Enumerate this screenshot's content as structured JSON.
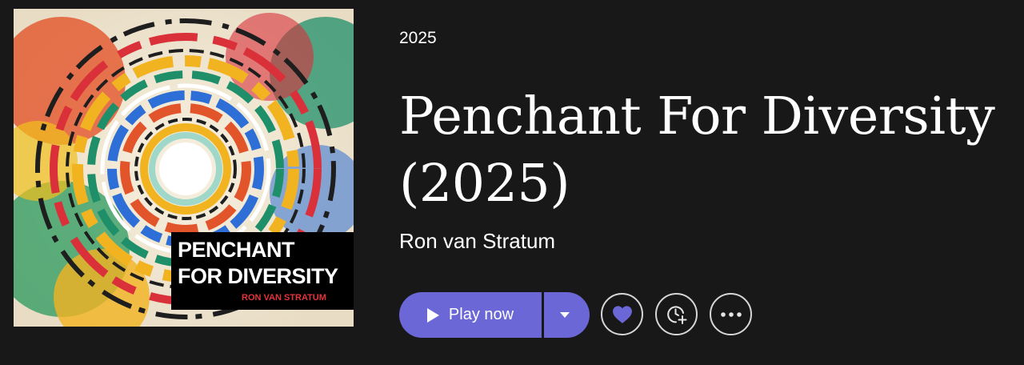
{
  "album": {
    "cover": {
      "title": "PENCHANT\nFOR DIVERSITY",
      "artist": "RON VAN STRATUM"
    },
    "year": "2025",
    "title": "Penchant For Diversity (2025)",
    "artist": "Ron van Stratum"
  },
  "actions": {
    "play_label": "Play now",
    "play_icon": "play-icon",
    "dropdown_icon": "chevron-down-icon",
    "favorite_icon": "heart-icon",
    "queue_icon": "clock-plus-icon",
    "more_icon": "more-horizontal-icon"
  },
  "colors": {
    "background": "#181818",
    "accent": "#6b67d6",
    "text": "#ffffff"
  }
}
